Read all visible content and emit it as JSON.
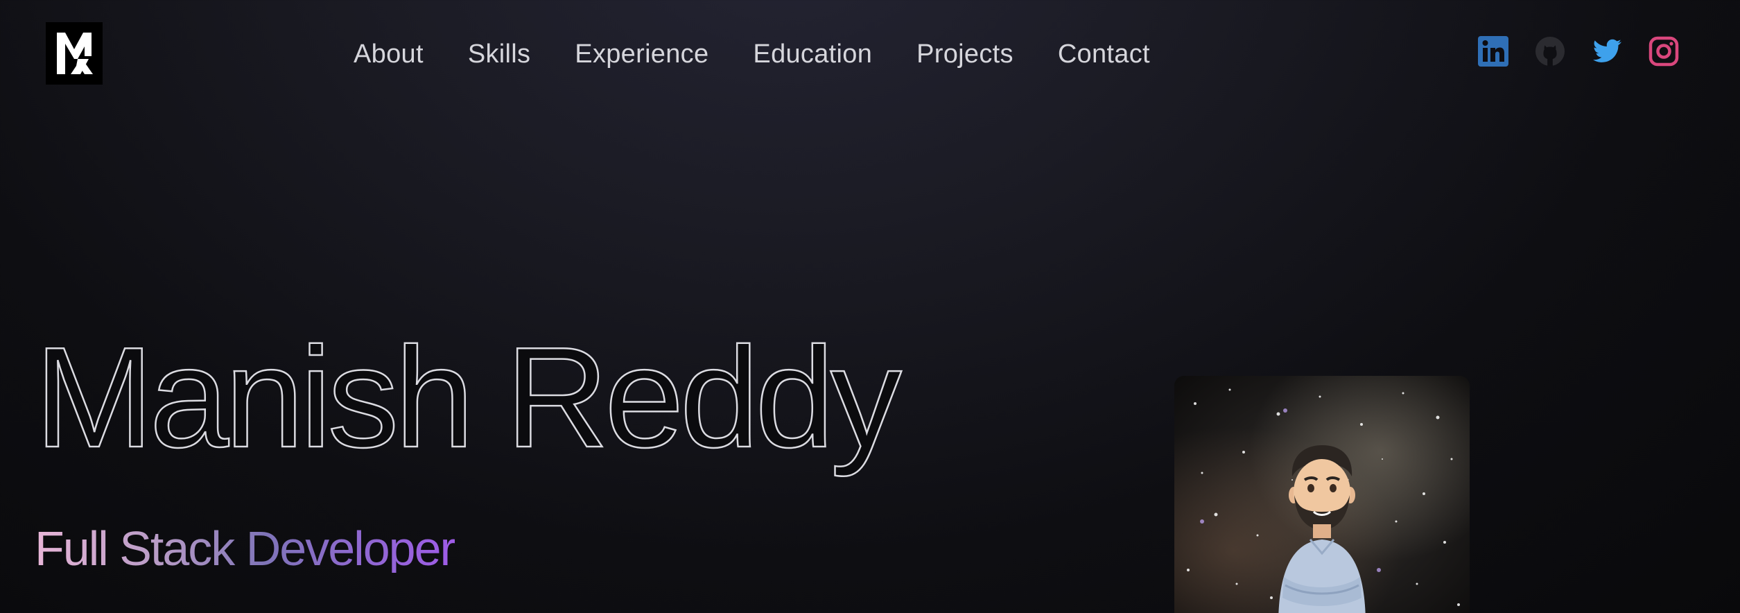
{
  "header": {
    "logo": {
      "name": "logo",
      "monogram": "MR"
    },
    "nav": [
      {
        "label": "About"
      },
      {
        "label": "Skills"
      },
      {
        "label": "Experience"
      },
      {
        "label": "Education"
      },
      {
        "label": "Projects"
      },
      {
        "label": "Contact"
      }
    ],
    "social": [
      {
        "icon": "linkedin-icon",
        "color": "#2f6fb6"
      },
      {
        "icon": "github-icon",
        "color": "#2b2b30"
      },
      {
        "icon": "twitter-icon",
        "color": "#3ea1ec"
      },
      {
        "icon": "instagram-icon",
        "color": "#d9477d"
      }
    ]
  },
  "hero": {
    "name": "Manish Reddy",
    "role": "Full Stack Developer",
    "avatar": {
      "icon": "avatar-memoji"
    }
  },
  "colors": {
    "background_top": "#242433",
    "background_bottom": "#09090b",
    "role_gradient_start": "#e8b6d8",
    "role_gradient_end": "#9f5ce8"
  }
}
